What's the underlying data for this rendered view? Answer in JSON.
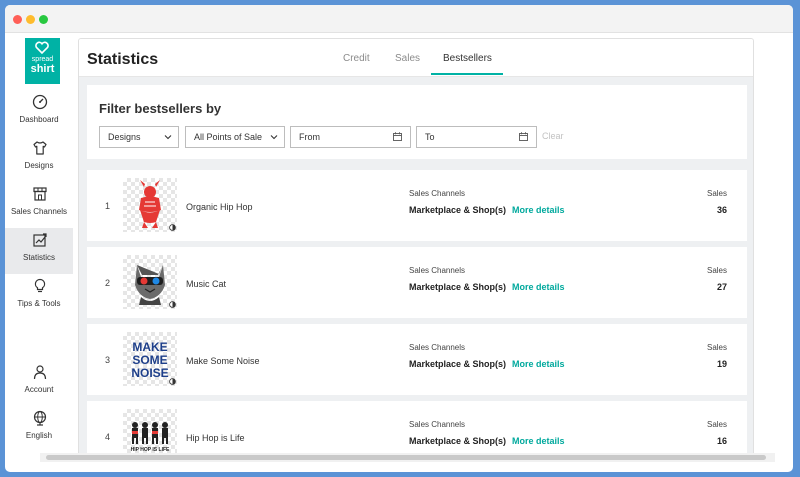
{
  "brand": {
    "line1": "spread",
    "line2": "shirt",
    "color": "#00b2a5"
  },
  "sidebar": {
    "items": [
      {
        "label": "Dashboard",
        "icon": "speedometer-icon",
        "active": false
      },
      {
        "label": "Designs",
        "icon": "tshirt-icon",
        "active": false
      },
      {
        "label": "Sales Channels",
        "icon": "storefront-icon",
        "active": false
      },
      {
        "label": "Statistics",
        "icon": "chart-icon",
        "active": true
      },
      {
        "label": "Tips & Tools",
        "icon": "lightbulb-icon",
        "active": false
      },
      {
        "label": "Account",
        "icon": "user-icon",
        "active": false
      },
      {
        "label": "English",
        "icon": "globe-icon",
        "active": false
      }
    ]
  },
  "header": {
    "title": "Statistics",
    "tabs": [
      {
        "label": "Credit",
        "active": false
      },
      {
        "label": "Sales",
        "active": false
      },
      {
        "label": "Bestsellers",
        "active": true
      }
    ]
  },
  "filter": {
    "title": "Filter bestsellers by",
    "type_select": "Designs",
    "points_select": "All Points of Sale",
    "from_placeholder": "From",
    "to_placeholder": "To",
    "clear_label": "Clear"
  },
  "rows_labels": {
    "sales_channels_label": "Sales Channels",
    "more_details_label": "More details",
    "sales_label": "Sales"
  },
  "bestsellers": [
    {
      "rank": "1",
      "name": "Organic Hip Hop",
      "channel": "Marketplace & Shop(s)",
      "sales": "36",
      "art": "organic-hip-hop"
    },
    {
      "rank": "2",
      "name": "Music Cat",
      "channel": "Marketplace & Shop(s)",
      "sales": "27",
      "art": "music-cat"
    },
    {
      "rank": "3",
      "name": "Make Some Noise",
      "channel": "Marketplace & Shop(s)",
      "sales": "19",
      "art": "make-some-noise",
      "art_text": [
        "MAKE",
        "SOME",
        "NOISE"
      ]
    },
    {
      "rank": "4",
      "name": "Hip Hop is Life",
      "channel": "Marketplace & Shop(s)",
      "sales": "16",
      "art": "hip-hop-is-life",
      "art_text": "HIP HOP IS LIFE"
    }
  ],
  "colors": {
    "accent": "#00b2a5",
    "link": "#00a99d",
    "background": "#eef0f2"
  }
}
